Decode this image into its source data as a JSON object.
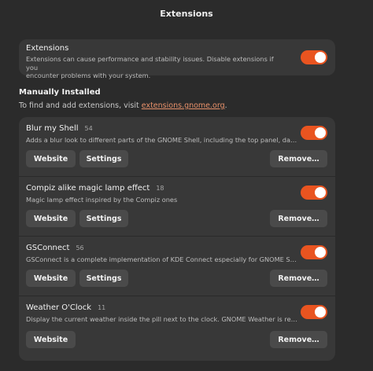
{
  "window": {
    "title": "Extensions"
  },
  "global": {
    "title": "Extensions",
    "description_line1": "Extensions can cause performance and stability issues. Disable extensions if you",
    "description_line2": "encounter problems with your system.",
    "enabled": true
  },
  "manual": {
    "heading": "Manually Installed",
    "desc_prefix": "To find and add extensions, visit ",
    "link": "extensions.gnome.org",
    "desc_suffix": "."
  },
  "buttons": {
    "website": "Website",
    "settings": "Settings",
    "remove": "Remove…"
  },
  "extensions": [
    {
      "name": "Blur my Shell",
      "version": "54",
      "description": "Adds a blur look to different parts of the GNOME Shell, including the top panel, dash and overview.",
      "enabled": true,
      "has_settings": true
    },
    {
      "name": "Compiz alike magic lamp effect",
      "version": "18",
      "description": "Magic lamp effect inspired by the Compiz ones",
      "enabled": true,
      "has_settings": true
    },
    {
      "name": "GSConnect",
      "version": "56",
      "description": "GSConnect is a complete implementation of KDE Connect especially for GNOME Shell with Nautilus integration.",
      "enabled": true,
      "has_settings": true
    },
    {
      "name": "Weather O'Clock",
      "version": "11",
      "description": "Display the current weather inside the pill next to the clock. GNOME Weather is required to be installed.",
      "enabled": true,
      "has_settings": false
    }
  ],
  "colors": {
    "accent": "#e95420",
    "background": "#2b2b2b",
    "card": "#383838",
    "button": "#4a4a4a"
  }
}
